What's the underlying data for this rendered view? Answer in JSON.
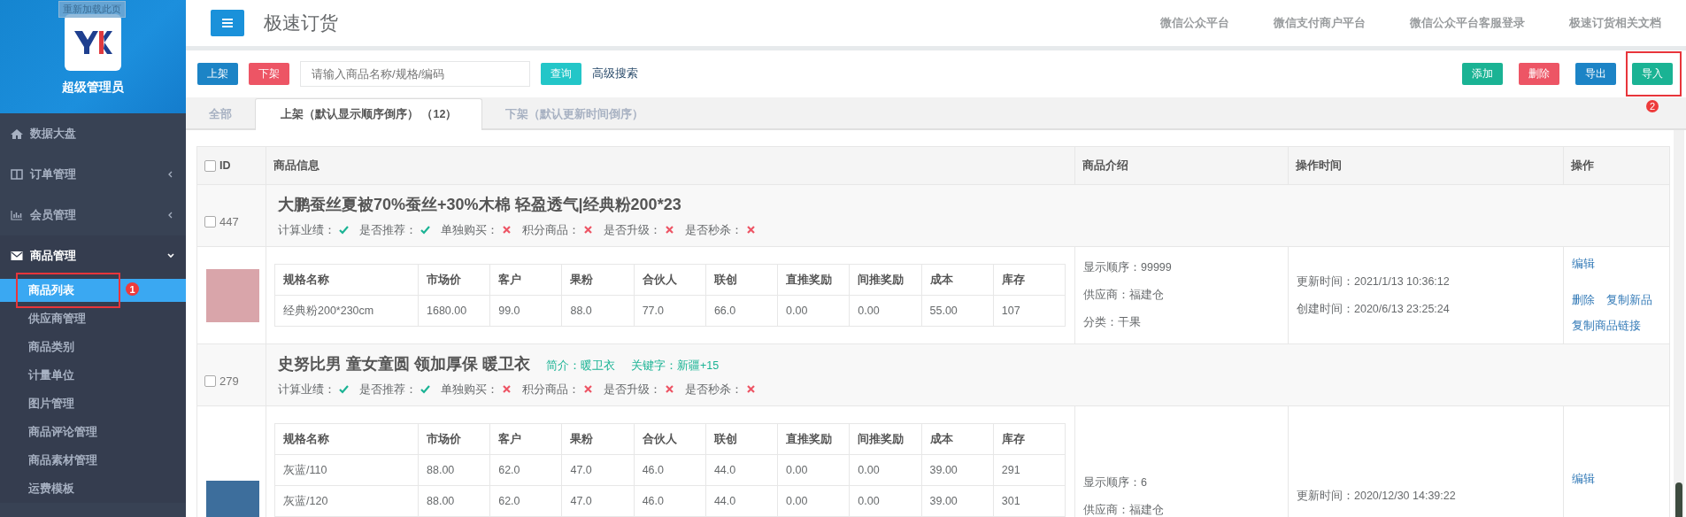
{
  "tooltip": "重新加载此页",
  "sidebar": {
    "user": "超级管理员",
    "items": [
      {
        "label": "数据大盘",
        "selected": false
      },
      {
        "label": "订单管理",
        "selected": false,
        "expanded": false
      },
      {
        "label": "会员管理",
        "selected": false,
        "expanded": false
      },
      {
        "label": "商品管理",
        "selected": true,
        "expanded": true,
        "children": [
          {
            "label": "商品列表",
            "selected": true,
            "callout": "1"
          },
          {
            "label": "供应商管理",
            "selected": false
          },
          {
            "label": "商品类别",
            "selected": false
          },
          {
            "label": "计量单位",
            "selected": false
          },
          {
            "label": "图片管理",
            "selected": false
          },
          {
            "label": "商品评论管理",
            "selected": false
          },
          {
            "label": "商品素材管理",
            "selected": false
          },
          {
            "label": "运费模板",
            "selected": false
          }
        ]
      }
    ]
  },
  "header": {
    "title": "极速订货",
    "links": [
      "微信公众平台",
      "微信支付商户平台",
      "微信公众平台客服登录",
      "极速订货相关文档"
    ]
  },
  "toolbar": {
    "left_buttons": [
      {
        "label": "上架",
        "kind": "primary"
      },
      {
        "label": "下架",
        "kind": "danger"
      }
    ],
    "search": {
      "placeholder": "请输入商品名称/规格/编码"
    },
    "query_button": "查询",
    "advanced_link": "高级搜索",
    "right_buttons": [
      {
        "label": "添加",
        "kind": "success"
      },
      {
        "label": "删除",
        "kind": "danger"
      },
      {
        "label": "导出",
        "kind": "primary"
      },
      {
        "label": "导入",
        "kind": "success",
        "callout": "2"
      }
    ]
  },
  "tabs": [
    {
      "label": "全部",
      "selected": false
    },
    {
      "label": "上架（默认显示顺序倒序） （12）",
      "selected": true
    },
    {
      "label": "下架（默认更新时间倒序）",
      "selected": false
    }
  ],
  "table": {
    "columns": [
      "ID",
      "商品信息",
      "商品介绍",
      "操作时间",
      "操作"
    ],
    "select_all_checked": false,
    "products": [
      {
        "id": "447",
        "checked": false,
        "title": "大鹏蚕丝夏被70%蚕丝+30%木棉 轻盈透气|经典粉200*23",
        "flags": [
          {
            "label": "计算业绩：",
            "on": true
          },
          {
            "label": "是否推荐：",
            "on": true
          },
          {
            "label": "单独购买：",
            "on": false
          },
          {
            "label": "积分商品：",
            "on": false
          },
          {
            "label": "是否升级：",
            "on": false
          },
          {
            "label": "是否秒杀：",
            "on": false
          }
        ],
        "spec_columns": [
          "规格名称",
          "市场价",
          "客户",
          "果粉",
          "合伙人",
          "联创",
          "直推奖励",
          "间推奖励",
          "成本",
          "库存"
        ],
        "spec_rows": [
          [
            "经典粉200*230cm",
            "1680.00",
            "99.0",
            "88.0",
            "77.0",
            "66.0",
            "0.00",
            "0.00",
            "55.00",
            "107"
          ]
        ],
        "intro": [
          "显示顺序：99999",
          "供应商：福建仓",
          "分类：干果"
        ],
        "times": [
          "更新时间：2021/1/13 10:36:12",
          "创建时间：2020/6/13 23:25:24"
        ],
        "actions": [
          [
            "编辑"
          ],
          [
            "删除",
            "复制新品"
          ],
          [
            "复制商品链接"
          ]
        ]
      },
      {
        "id": "279",
        "checked": false,
        "title": "史努比男 童女童圆 领加厚保 暖卫衣",
        "tags": [
          "简介：暖卫衣",
          "关键字：新疆+15"
        ],
        "flags": [
          {
            "label": "计算业绩：",
            "on": true
          },
          {
            "label": "是否推荐：",
            "on": true
          },
          {
            "label": "单独购买：",
            "on": false
          },
          {
            "label": "积分商品：",
            "on": false
          },
          {
            "label": "是否升级：",
            "on": false
          },
          {
            "label": "是否秒杀：",
            "on": false
          }
        ],
        "spec_columns": [
          "规格名称",
          "市场价",
          "客户",
          "果粉",
          "合伙人",
          "联创",
          "直推奖励",
          "间推奖励",
          "成本",
          "库存"
        ],
        "spec_rows": [
          [
            "灰蓝/110",
            "88.00",
            "62.0",
            "47.0",
            "46.0",
            "44.0",
            "0.00",
            "0.00",
            "39.00",
            "291"
          ],
          [
            "灰蓝/120",
            "88.00",
            "62.0",
            "47.0",
            "46.0",
            "44.0",
            "0.00",
            "0.00",
            "39.00",
            "301"
          ]
        ],
        "intro": [
          "显示顺序：6",
          "供应商：福建仓"
        ],
        "times": [
          "更新时间：2020/12/30 14:39:22"
        ],
        "actions": [
          [
            "编辑"
          ]
        ]
      }
    ]
  }
}
